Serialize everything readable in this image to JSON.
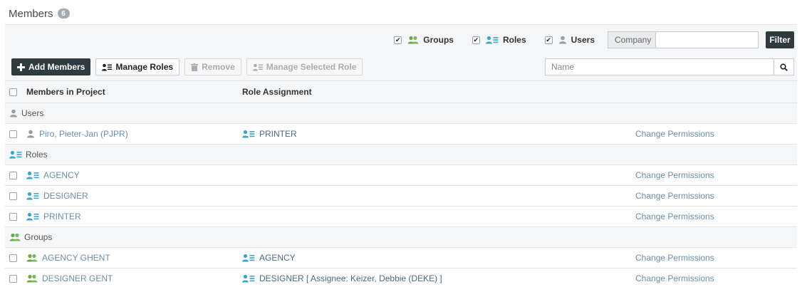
{
  "page": {
    "title": "Members",
    "count": "6"
  },
  "filters": {
    "groups": {
      "label": "Groups",
      "checked": true
    },
    "roles": {
      "label": "Roles",
      "checked": true
    },
    "users": {
      "label": "Users",
      "checked": true
    },
    "company_label": "Company",
    "company_value": "",
    "filter_button": "Filter"
  },
  "actions": {
    "add_members": "Add Members",
    "manage_roles": "Manage Roles",
    "remove": "Remove",
    "manage_selected_role": "Manage Selected Role"
  },
  "search": {
    "placeholder": "Name"
  },
  "table": {
    "headers": {
      "members": "Members in Project",
      "role": "Role Assignment"
    },
    "sections": {
      "users": "Users",
      "roles": "Roles",
      "groups": "Groups"
    },
    "users": [
      {
        "name": "Piro, Pieter-Jan (PJPR)",
        "role": "PRINTER",
        "action": "Change Permissions"
      }
    ],
    "roles": [
      {
        "name": "AGENCY",
        "role": "",
        "action": "Change Permissions"
      },
      {
        "name": "DESIGNER",
        "role": "",
        "action": "Change Permissions"
      },
      {
        "name": "PRINTER",
        "role": "",
        "action": "Change Permissions"
      }
    ],
    "groups": [
      {
        "name": "AGENCY GHENT",
        "role": "AGENCY",
        "action": "Change Permissions"
      },
      {
        "name": "DESIGNER GENT",
        "role": "DESIGNER [ Assignee: Keizer, Debbie (DEKE) ]",
        "action": "Change Permissions"
      }
    ]
  },
  "colors": {
    "dark_button": "#2f3b3e",
    "link": "#6b8ea8",
    "group_icon": "#6aa84f",
    "role_icon": "#3fa3c9",
    "user_icon": "#9a9ea3"
  }
}
